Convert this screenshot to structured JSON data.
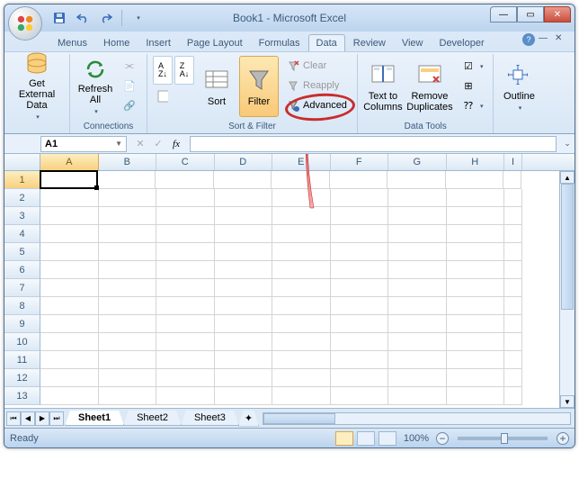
{
  "title": "Book1 - Microsoft Excel",
  "tabs": {
    "menus": "Menus",
    "home": "Home",
    "insert": "Insert",
    "page_layout": "Page Layout",
    "formulas": "Formulas",
    "data": "Data",
    "review": "Review",
    "view": "View",
    "developer": "Developer"
  },
  "ribbon": {
    "get_external_data": "Get External\nData",
    "refresh_all": "Refresh\nAll",
    "connections_label": "Connections",
    "sort": "Sort",
    "filter": "Filter",
    "clear": "Clear",
    "reapply": "Reapply",
    "advanced": "Advanced",
    "sort_filter_label": "Sort & Filter",
    "text_to_columns": "Text to\nColumns",
    "remove_duplicates": "Remove\nDuplicates",
    "data_tools_label": "Data Tools",
    "outline": "Outline"
  },
  "name_box": "A1",
  "fx_label": "fx",
  "columns": [
    "A",
    "B",
    "C",
    "D",
    "E",
    "F",
    "G",
    "H",
    "I"
  ],
  "rows": [
    1,
    2,
    3,
    4,
    5,
    6,
    7,
    8,
    9,
    10,
    11,
    12,
    13
  ],
  "sheets": {
    "s1": "Sheet1",
    "s2": "Sheet2",
    "s3": "Sheet3"
  },
  "status": "Ready",
  "zoom": "100%"
}
